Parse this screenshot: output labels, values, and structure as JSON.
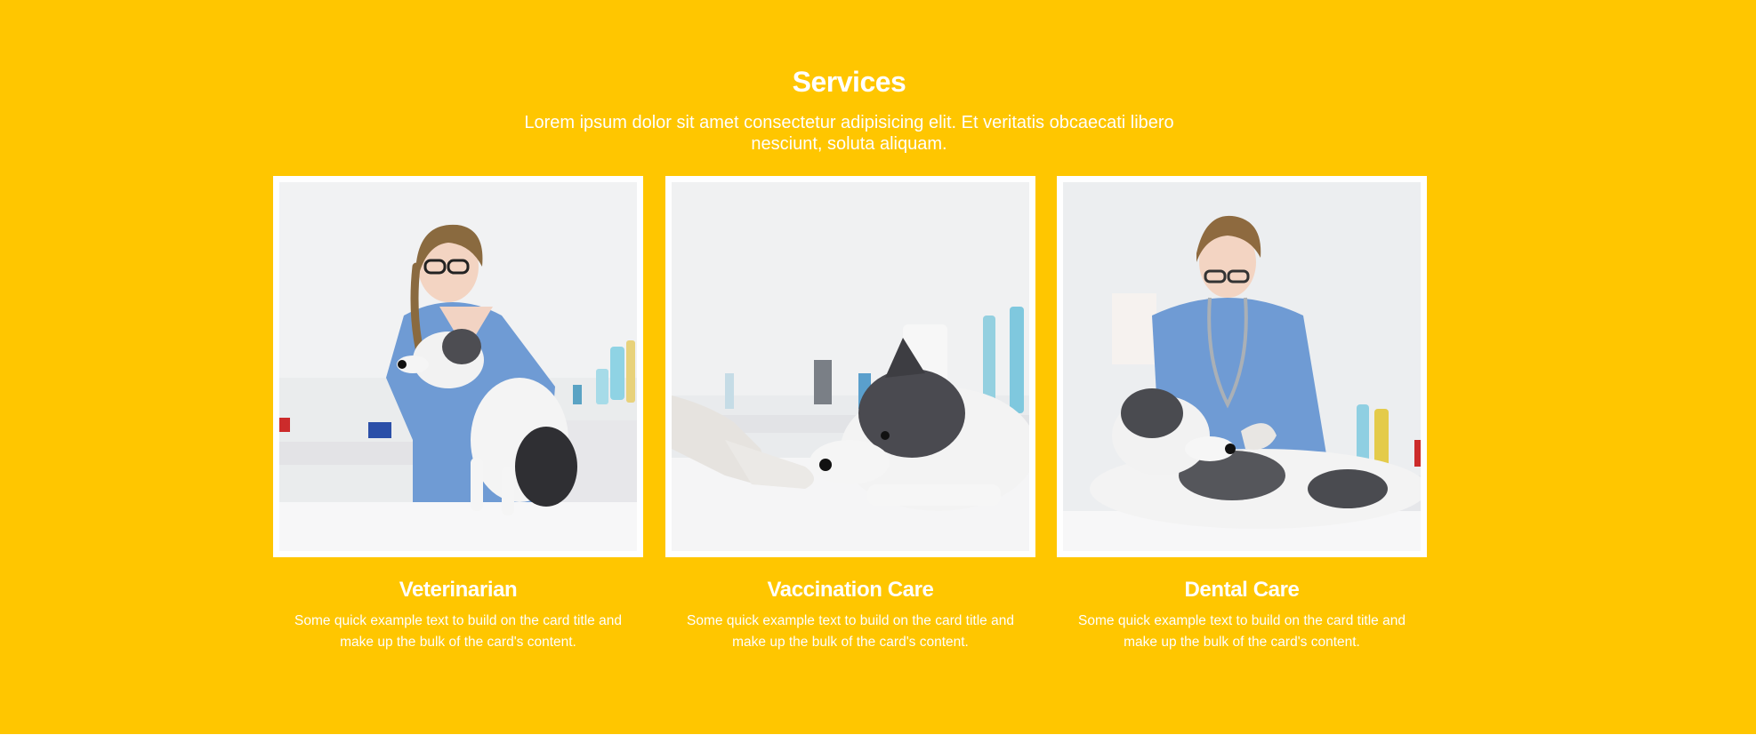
{
  "section": {
    "title": "Services",
    "lead": "Lorem ipsum dolor sit amet consectetur adipisicing elit. Et veritatis obcaecati libero nesciunt, soluta aliquam.",
    "background_color": "#ffc600",
    "text_color": "#ffffff"
  },
  "cards": [
    {
      "image": "veterinarian-with-dog-photo",
      "title": "Veterinarian",
      "text": "Some quick example text to build on the card title and make up the bulk of the card's content."
    },
    {
      "image": "vaccination-dog-photo",
      "title": "Vaccination Care",
      "text": "Some quick example text to build on the card title and make up the bulk of the card's content."
    },
    {
      "image": "dental-care-dog-photo",
      "title": "Dental Care",
      "text": "Some quick example text to build on the card title and make up the bulk of the card's content."
    }
  ]
}
